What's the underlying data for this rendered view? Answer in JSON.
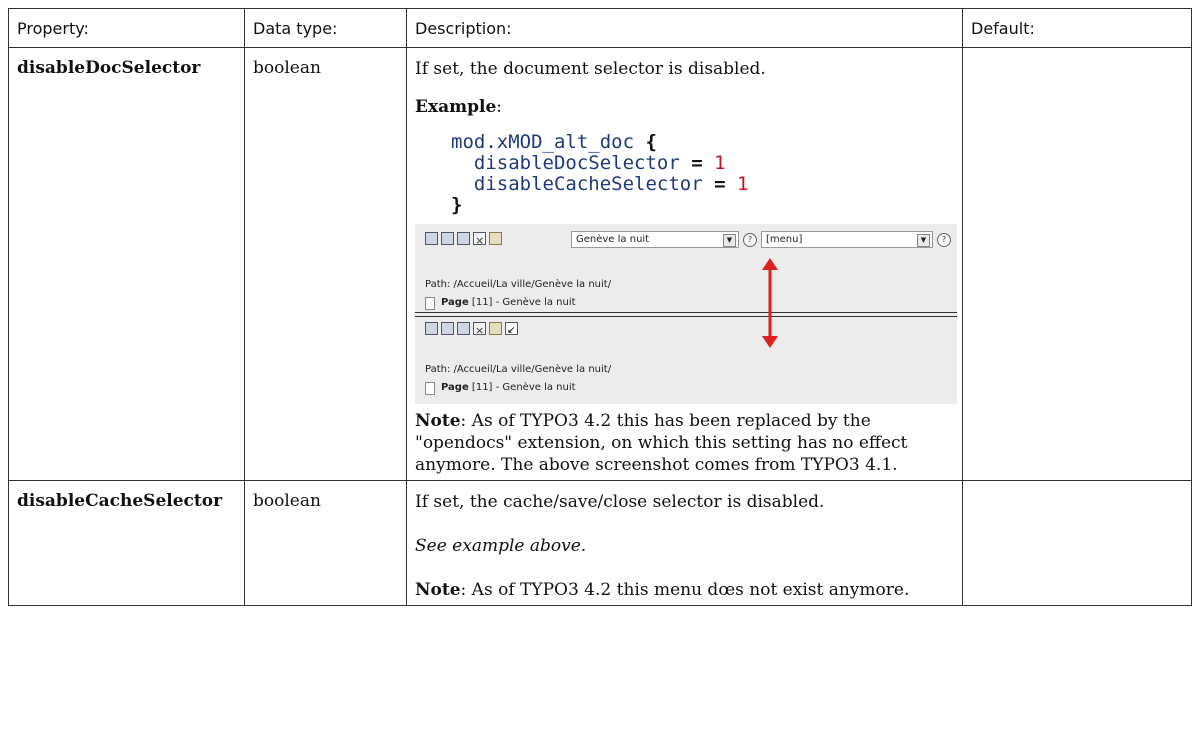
{
  "headers": {
    "property": "Property:",
    "datatype": "Data type:",
    "description": "Description:",
    "default": "Default:"
  },
  "rows": [
    {
      "property": "disableDocSelector",
      "datatype": "boolean",
      "default": "",
      "intro": "If set, the document selector is disabled.",
      "example_label": "Example",
      "example_colon": ":",
      "code": {
        "line1_prefix": "mod.xMOD_alt_doc ",
        "open_brace": "{",
        "line2_prop": "disableDocSelector",
        "line2_eq": " = ",
        "line2_val": "1",
        "line3_prop": "disableCacheSelector",
        "line3_eq": " = ",
        "line3_val": "1",
        "close_brace": "}"
      },
      "screenshot": {
        "doc_select_value": "Genève la nuit",
        "menu_select_value": "[menu]",
        "path_text": "Path: /Accueil/La ville/Genève la nuit/",
        "page_bold": "Page",
        "page_rest": " [11] - Genève la nuit",
        "help_glyph": "?",
        "arrow_glyph": "▼",
        "arrow_color": "#e02020"
      },
      "note_label": "Note",
      "note_text": ": As of TYPO3 4.2 this has been replaced by the \"opendocs\" extension, on which this setting has no effect anymore. The above screenshot comes from TYPO3 4.1."
    },
    {
      "property": "disableCacheSelector",
      "datatype": "boolean",
      "default": "",
      "intro": "If set, the cache/save/close selector is disabled.",
      "see_example": "See example above.",
      "note_label": "Note",
      "note_text": ": As of TYPO3 4.2 this menu dœs not exist anymore."
    }
  ]
}
